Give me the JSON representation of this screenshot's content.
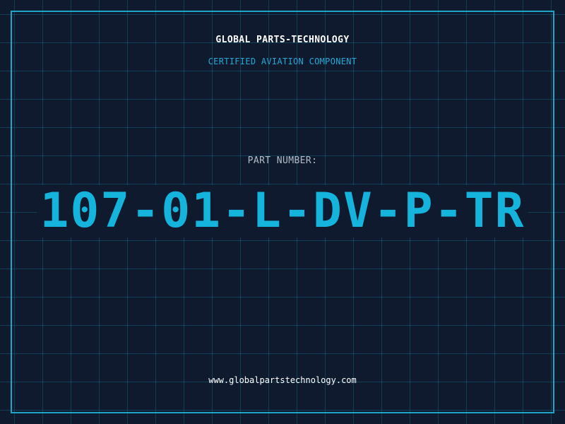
{
  "header": {
    "company_name": "GLOBAL PARTS-TECHNOLOGY",
    "certification": "CERTIFIED AVIATION COMPONENT"
  },
  "part": {
    "label": "PART NUMBER:",
    "number": "107-01-L-DV-P-TR"
  },
  "footer": {
    "website": "www.globalpartstechnology.com"
  },
  "colors": {
    "background": "#0f1a2e",
    "grid": "#1878a0",
    "accent": "#14b4dc",
    "frame": "#1fa5c8",
    "label": "#b4bcc8",
    "text": "#ffffff"
  }
}
